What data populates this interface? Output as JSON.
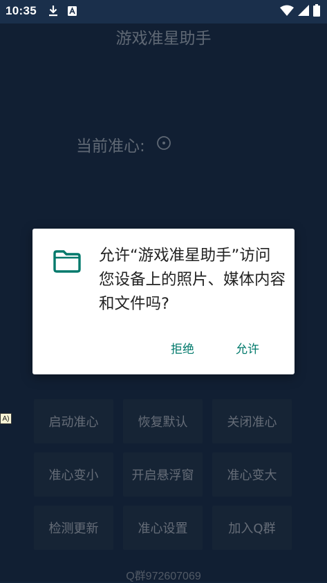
{
  "status_bar": {
    "time": "10:35",
    "icons": [
      "download-icon",
      "a-badge-icon",
      "wifi-icon",
      "signal-icon",
      "battery-icon"
    ]
  },
  "app": {
    "title": "游戏准星助手",
    "crosshair_label": "当前准心:",
    "crosshair_icon": "crosshair-circle-icon",
    "buttons": [
      {
        "label": "启动准心"
      },
      {
        "label": "恢复默认"
      },
      {
        "label": "关闭准心"
      },
      {
        "label": "准心变小"
      },
      {
        "label": "开启悬浮窗"
      },
      {
        "label": "准心变大"
      },
      {
        "label": "检测更新"
      },
      {
        "label": "准心设置"
      },
      {
        "label": "加入Q群"
      }
    ],
    "qq_group": "Q群972607069"
  },
  "side_tag": "A)",
  "dialog": {
    "icon": "folder-icon",
    "message": "允许“游戏准星助手”访问您设备上的照片、媒体内容和文件吗?",
    "deny_label": "拒绝",
    "allow_label": "允许"
  },
  "colors": {
    "background": "#1a2f4b",
    "button_bg": "#25384f",
    "accent": "#00796b",
    "dialog_bg": "#ffffff"
  }
}
